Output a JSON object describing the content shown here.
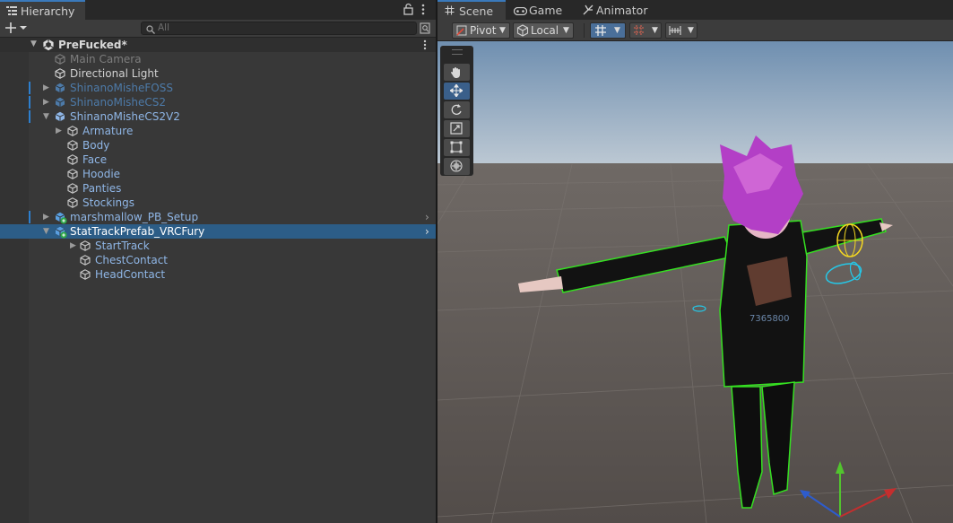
{
  "hierarchy": {
    "tab_label": "Hierarchy",
    "search_placeholder": "All",
    "scene_name": "PreFucked*",
    "items": [
      {
        "label": "Main Camera",
        "icon": "cube-icon",
        "color": "#7d7d7d",
        "depth": 1
      },
      {
        "label": "Directional Light",
        "icon": "cube-icon",
        "color": "#d2d2d2",
        "depth": 1
      },
      {
        "label": "ShinanoMisheFOSS",
        "icon": "prefab-icon",
        "color": "#4d7aa8",
        "depth": 1
      },
      {
        "label": "ShinanoMisheCS2",
        "icon": "prefab-icon",
        "color": "#4d7aa8",
        "depth": 1
      },
      {
        "label": "ShinanoMisheCS2V2",
        "icon": "prefab-icon",
        "color": "#8fb6e6",
        "depth": 1
      },
      {
        "label": "Armature",
        "icon": "cube-icon",
        "color": "#8fb6e6",
        "depth": 2
      },
      {
        "label": "Body",
        "icon": "cube-icon",
        "color": "#8fb6e6",
        "depth": 2
      },
      {
        "label": "Face",
        "icon": "cube-icon",
        "color": "#8fb6e6",
        "depth": 2
      },
      {
        "label": "Hoodie",
        "icon": "cube-icon",
        "color": "#8fb6e6",
        "depth": 2
      },
      {
        "label": "Panties",
        "icon": "cube-icon",
        "color": "#8fb6e6",
        "depth": 2
      },
      {
        "label": "Stockings",
        "icon": "cube-icon",
        "color": "#8fb6e6",
        "depth": 2
      },
      {
        "label": "marshmallow_PB_Setup",
        "icon": "prefab-icon",
        "color": "#8fb6e6",
        "depth": 1
      },
      {
        "label": "StatTrackPrefab_VRCFury",
        "icon": "prefab-icon",
        "color": "#ffffff",
        "depth": 1
      },
      {
        "label": "StartTrack",
        "icon": "cube-icon",
        "color": "#8fb6e6",
        "depth": 2
      },
      {
        "label": "ChestContact",
        "icon": "cube-icon",
        "color": "#8fb6e6",
        "depth": 3
      },
      {
        "label": "HeadContact",
        "icon": "cube-icon",
        "color": "#8fb6e6",
        "depth": 3
      }
    ]
  },
  "scene_view": {
    "tabs": [
      {
        "label": "Scene",
        "icon": "hash-icon"
      },
      {
        "label": "Game",
        "icon": "gamepad-icon"
      },
      {
        "label": "Animator",
        "icon": "animator-icon"
      }
    ],
    "pivot_label": "Pivot",
    "local_label": "Local",
    "tools": [
      "hand-tool-icon",
      "move-tool-icon",
      "rotate-tool-icon",
      "scale-tool-icon",
      "rect-tool-icon",
      "transform-tool-icon"
    ],
    "hoodie_text": "7365800"
  },
  "colors": {
    "accent": "#3a79bb",
    "selection": "#2c5d87",
    "panel": "#383838",
    "sky": "#8aa9c5",
    "ground": "#5e5855",
    "outline": "#35e021"
  }
}
